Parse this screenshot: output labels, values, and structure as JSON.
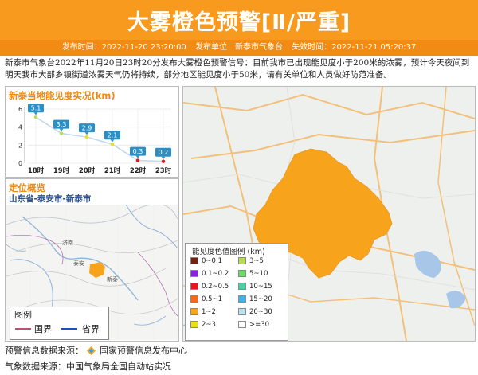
{
  "header": {
    "title": "大雾橙色预警[Ⅱ/严重]",
    "publish_time": "发布时间：2022-11-20 23:20:00",
    "publisher": "发布单位：新泰市气象台",
    "expire_time": "失效时间：2022-11-21 05:20:37"
  },
  "description": "新泰市气象台2022年11月20日23时20分发布大雾橙色预警信号：目前我市已出现能见度小于200米的浓雾，预计今天夜间到明天我市大部乡镇街道浓雾天气仍将持续，部分地区能见度小于50米，请有关单位和人员做好防范准备。",
  "visibility_panel": {
    "title": "新泰当地能见度实况(km)"
  },
  "chart_data": {
    "type": "line",
    "title": "新泰当地能见度实况(km)",
    "categories": [
      "18时",
      "19时",
      "20时",
      "21时",
      "22时",
      "23时"
    ],
    "values": [
      5.1,
      3.3,
      2.9,
      2.1,
      0.3,
      0.2
    ],
    "labels": [
      "5.1",
      "3.3",
      "2.9",
      "2.1",
      "0.3",
      "0.2"
    ],
    "yticks": [
      "0",
      "2",
      "4",
      "6"
    ],
    "ylim": [
      0,
      6
    ],
    "grid": true
  },
  "location_panel": {
    "title": "定位概览",
    "subtitle": "山东省-泰安市-新泰市",
    "legend_title": "图例",
    "legend_country": "国界",
    "legend_province": "省界",
    "map_labels": [
      "济南",
      "泰安",
      "新泰"
    ]
  },
  "map_legend": {
    "title": "能见度色值图例 (km)",
    "items": [
      {
        "label": "0~0.1",
        "color": "#7a1f12"
      },
      {
        "label": "3~5",
        "color": "#b8e04a"
      },
      {
        "label": "0.1~0.2",
        "color": "#8b22d6"
      },
      {
        "label": "5~10",
        "color": "#6ed86a"
      },
      {
        "label": "0.2~0.5",
        "color": "#e8131c"
      },
      {
        "label": "10~15",
        "color": "#3fd6a8"
      },
      {
        "label": "0.5~1",
        "color": "#f26a1b"
      },
      {
        "label": "15~20",
        "color": "#3cb6f0"
      },
      {
        "label": "1~2",
        "color": "#f7a31c"
      },
      {
        "label": "20~30",
        "color": "#bde3ee"
      },
      {
        "label": "2~3",
        "color": "#e8e01c"
      },
      {
        "label": ">=30",
        "color": "#ffffff"
      }
    ]
  },
  "footer": {
    "source1": "预警信息数据来源：",
    "source1_name": "国家预警信息发布中心",
    "source2": "气象数据来源：中国气象局全国自动站实况"
  },
  "colors": {
    "accent": "#f79a1e",
    "fog_area": "#f7a31c",
    "line": "#c3d9ee"
  }
}
